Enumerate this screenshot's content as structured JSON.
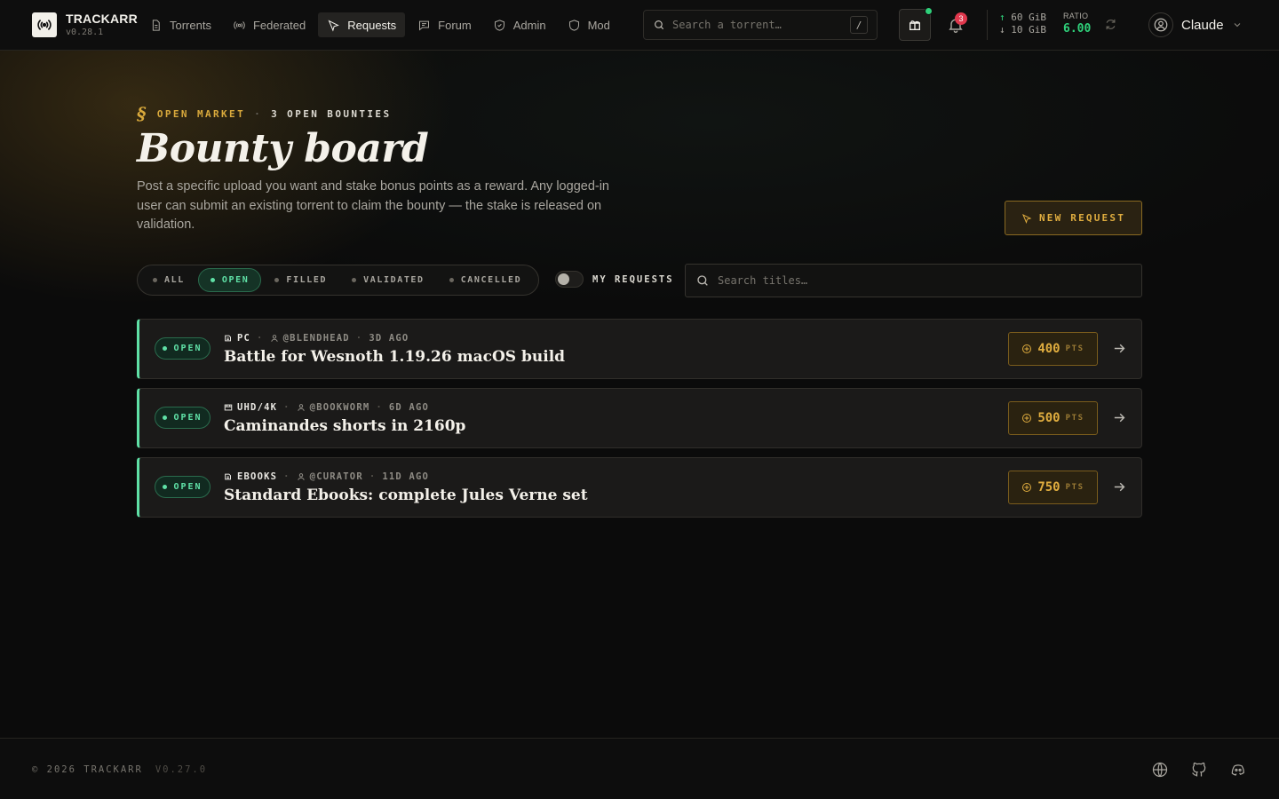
{
  "brand": {
    "name": "TRACKARR",
    "version": "v0.28.1"
  },
  "nav": [
    {
      "label": "Torrents",
      "icon": "file-icon"
    },
    {
      "label": "Federated",
      "icon": "broadcast-icon"
    },
    {
      "label": "Requests",
      "icon": "pointer-icon",
      "active": true
    },
    {
      "label": "Forum",
      "icon": "chat-icon"
    },
    {
      "label": "Admin",
      "icon": "shield-check-icon"
    },
    {
      "label": "Mod",
      "icon": "shield-icon"
    }
  ],
  "search": {
    "placeholder": "Search a torrent…",
    "shortcut": "/"
  },
  "notifications": {
    "count": "3"
  },
  "stats": {
    "upload": "60 GiB",
    "download": "10 GiB",
    "ratio_label": "RATIO",
    "ratio": "6.00"
  },
  "user": {
    "name": "Claude"
  },
  "hero": {
    "eyebrow_symbol": "§",
    "eyebrow_a": "OPEN MARKET",
    "eyebrow_sep": "·",
    "eyebrow_b": "3 OPEN BOUNTIES",
    "title": "Bounty board",
    "description": "Post a specific upload you want and stake bonus points as a reward. Any logged-in user can submit an existing torrent to claim the bounty — the stake is released on validation.",
    "new_request": "NEW REQUEST"
  },
  "filters": {
    "tabs": [
      "ALL",
      "OPEN",
      "FILLED",
      "VALIDATED",
      "CANCELLED"
    ],
    "active": "OPEN",
    "toggle_label": "MY REQUESTS",
    "search_placeholder": "Search titles…"
  },
  "requests": [
    {
      "status": "OPEN",
      "category": "PC",
      "author": "@BLENDHEAD",
      "age": "3D AGO",
      "title": "Battle for Wesnoth 1.19.26 macOS build",
      "points": "400",
      "unit": "PTS"
    },
    {
      "status": "OPEN",
      "category": "UHD/4K",
      "author": "@BOOKWORM",
      "age": "6D AGO",
      "title": "Caminandes shorts in 2160p",
      "points": "500",
      "unit": "PTS"
    },
    {
      "status": "OPEN",
      "category": "EBOOKS",
      "author": "@CURATOR",
      "age": "11D AGO",
      "title": "Standard Ebooks: complete Jules Verne set",
      "points": "750",
      "unit": "PTS"
    }
  ],
  "footer": {
    "copyright": "© 2026 TRACKARR",
    "version": "V0.27.0"
  },
  "colors": {
    "accent_gold": "#e0ad3f",
    "accent_green": "#5fe0a6",
    "ratio_green": "#2fd07a",
    "badge_red": "#e0384d"
  }
}
